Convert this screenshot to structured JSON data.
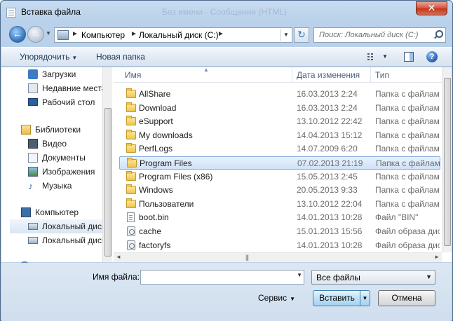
{
  "window": {
    "title": "Вставка файла",
    "ghost_title": "Без имени - Сообщение (HTML)"
  },
  "address": {
    "crumbs": [
      "Компьютер",
      "Локальный диск (C:)"
    ],
    "search_placeholder": "Поиск: Локальный диск (C:)"
  },
  "toolbar": {
    "organize_label": "Упорядочить",
    "new_folder_label": "Новая папка",
    "help_glyph": "?"
  },
  "nav": {
    "items": [
      {
        "label": "Загрузки",
        "icon": "downloads-icon"
      },
      {
        "label": "Недавние места",
        "icon": "recent-places-icon"
      },
      {
        "label": "Рабочий стол",
        "icon": "desktop-icon"
      },
      {
        "label": "Библиотеки",
        "icon": "libraries-icon"
      },
      {
        "label": "Видео",
        "icon": "video-icon"
      },
      {
        "label": "Документы",
        "icon": "documents-icon"
      },
      {
        "label": "Изображения",
        "icon": "images-icon"
      },
      {
        "label": "Музыка",
        "icon": "music-icon"
      },
      {
        "label": "Компьютер",
        "icon": "computer-icon"
      },
      {
        "label": "Локальный диск (C:)",
        "icon": "local-disk-icon"
      },
      {
        "label": "Локальный диск (D:)",
        "icon": "local-disk-icon"
      }
    ]
  },
  "files": {
    "columns": {
      "name": "Имя",
      "date": "Дата изменения",
      "type": "Тип"
    },
    "rows": [
      {
        "name": "AllShare",
        "date": "16.03.2013 2:24",
        "type": "Папка с файлами",
        "icon": "folder-icon"
      },
      {
        "name": "Download",
        "date": "16.03.2013 2:24",
        "type": "Папка с файлами",
        "icon": "folder-icon"
      },
      {
        "name": "eSupport",
        "date": "13.10.2012 22:42",
        "type": "Папка с файлами",
        "icon": "folder-icon"
      },
      {
        "name": "My downloads",
        "date": "14.04.2013 15:12",
        "type": "Папка с файлами",
        "icon": "folder-icon"
      },
      {
        "name": "PerfLogs",
        "date": "14.07.2009 6:20",
        "type": "Папка с файлами",
        "icon": "folder-icon"
      },
      {
        "name": "Program Files",
        "date": "07.02.2013 21:19",
        "type": "Папка с файлами",
        "icon": "folder-icon"
      },
      {
        "name": "Program Files (x86)",
        "date": "15.05.2013 2:45",
        "type": "Папка с файлами",
        "icon": "folder-icon"
      },
      {
        "name": "Windows",
        "date": "20.05.2013 9:33",
        "type": "Папка с файлами",
        "icon": "folder-icon"
      },
      {
        "name": "Пользователи",
        "date": "13.10.2012 22:04",
        "type": "Папка с файлами",
        "icon": "folder-icon"
      },
      {
        "name": "boot.bin",
        "date": "14.01.2013 10:28",
        "type": "Файл \"BIN\"",
        "icon": "file-icon"
      },
      {
        "name": "cache",
        "date": "15.01.2013 15:56",
        "type": "Файл образа диска",
        "icon": "disk-image-icon"
      },
      {
        "name": "factoryfs",
        "date": "14.01.2013 10:28",
        "type": "Файл образа диска",
        "icon": "disk-image-icon"
      }
    ],
    "selected_index": 5
  },
  "bottom": {
    "filename_label": "Имя файла:",
    "filename_value": "",
    "filetype_value": "Все файлы",
    "service_label": "Сервис",
    "insert_label": "Вставить",
    "cancel_label": "Отмена"
  },
  "colors": {
    "selection": "#cfe2f8",
    "selection_border": "#84acdd",
    "close": "#c1361e",
    "accent": "#3c7fb1"
  }
}
